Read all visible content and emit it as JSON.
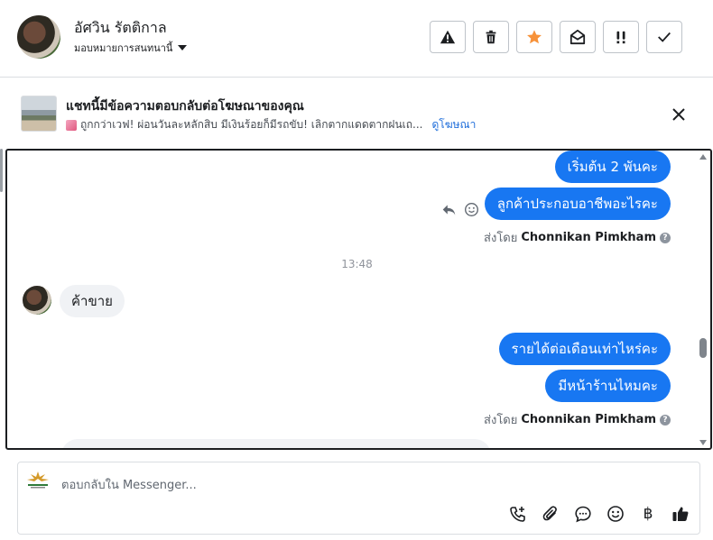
{
  "header": {
    "contact_name": "อัศวิน รัตติกาล",
    "assign_label": "มอบหมายการสนทนานี้",
    "toolbar": [
      {
        "name": "spam-button",
        "icon": "warning-icon"
      },
      {
        "name": "delete-button",
        "icon": "trash-icon"
      },
      {
        "name": "star-button",
        "icon": "star-icon"
      },
      {
        "name": "mark-unread-button",
        "icon": "envelope-open-icon"
      },
      {
        "name": "follow-up-button",
        "icon": "exclamation-icon"
      },
      {
        "name": "mark-done-button",
        "icon": "check-icon"
      }
    ],
    "accent_star": "#f7923a"
  },
  "ad_banner": {
    "title": "แชทนี้มีข้อความตอบกลับต่อโฆษณาของคุณ",
    "snippet": "ถูกกว่าเวฟ! ผ่อนวันละหลักสิบ มีเงินร้อยก็มีรถขับ! เลิกตากแดดตากฝนเถ...",
    "link": "ดูโฆษณา"
  },
  "messages": {
    "out_1": "เริ่มต้น 2 พันคะ",
    "out_2": "ลูกค้าประกอบอาชีพอะไรคะ",
    "sent_by_prefix": "ส่งโดย",
    "sender": "Chonnikan Pimkham",
    "timestamp": "13:48",
    "in_1": "ค้าขาย",
    "out_3": "รายได้ต่อเดือนเท่าไหร่คะ",
    "out_4": "มีหน้าร้านไหมคะ",
    "sent_by_prefix_2": "ส่งโดย",
    "sender_2": "Chonnikan Pimkham"
  },
  "composer": {
    "placeholder": "ตอบกลับใน Messenger...",
    "tools": [
      "call-add-icon",
      "attachment-icon",
      "saved-reply-icon",
      "emoji-icon",
      "baht-icon",
      "thumbs-up-icon"
    ],
    "baht_symbol": "฿"
  },
  "colors": {
    "outgoing_bubble": "#1877f2",
    "incoming_bubble": "#f0f2f5",
    "link": "#216fdb"
  }
}
